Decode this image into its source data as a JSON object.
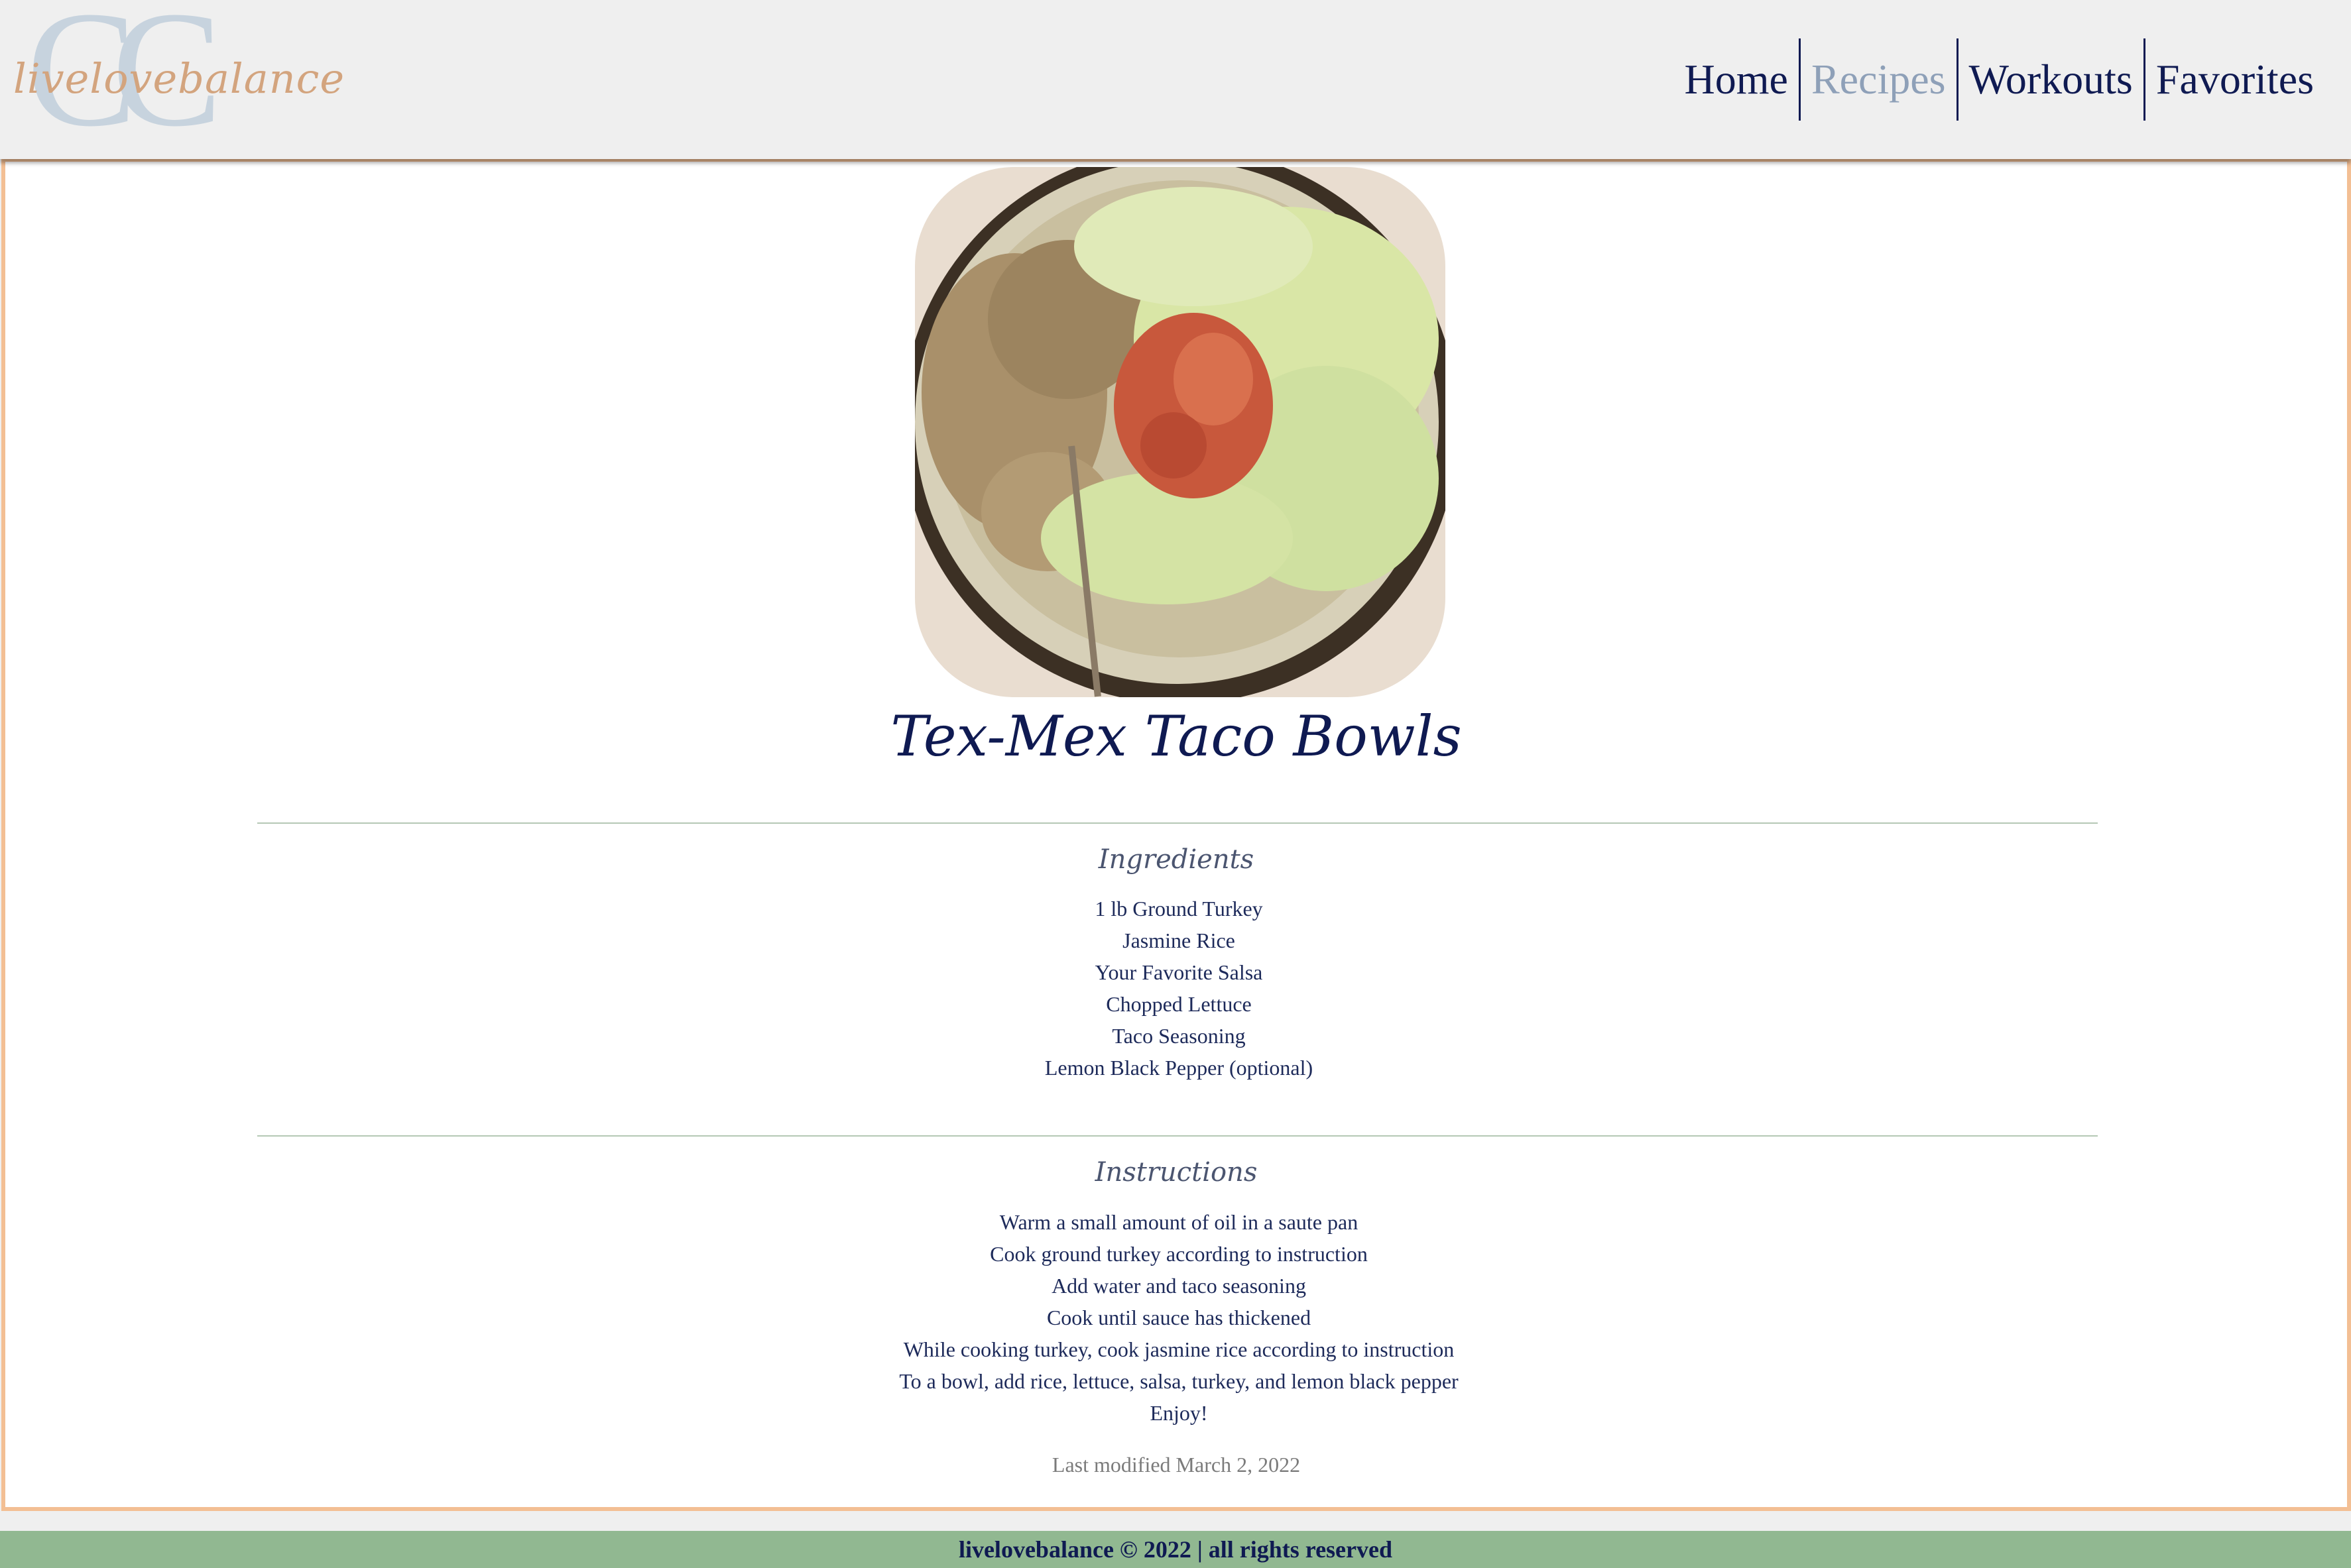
{
  "brand": {
    "monogram": "CC",
    "script": "livelovebalance"
  },
  "nav": {
    "items": [
      {
        "label": "Home",
        "active": false
      },
      {
        "label": "Recipes",
        "active": true
      },
      {
        "label": "Workouts",
        "active": false
      },
      {
        "label": "Favorites",
        "active": false
      }
    ]
  },
  "recipe": {
    "image_icon": "taco-bowl-photo",
    "title": "Tex-Mex Taco Bowls",
    "ingredients_heading": "Ingredients",
    "ingredients": [
      "1 lb Ground Turkey",
      "Jasmine Rice",
      "Your Favorite Salsa",
      "Chopped Lettuce",
      "Taco Seasoning",
      "Lemon Black Pepper (optional)"
    ],
    "instructions_heading": "Instructions",
    "instructions": [
      "Warm a small amount of oil in a saute pan",
      "Cook ground turkey according to instruction",
      "Add water and taco seasoning",
      "Cook until sauce has thickened",
      "While cooking turkey, cook jasmine rice according to instruction",
      "To a bowl, add rice, lettuce, salsa, turkey, and lemon black pepper",
      "Enjoy!"
    ],
    "last_modified": "Last modified March 2, 2022"
  },
  "footer": {
    "text": "livelovebalance © 2022 | all rights reserved"
  },
  "colors": {
    "navy": "#0f1a52",
    "active_nav": "#8ea0b8",
    "border": "#f3bf94",
    "footer_bg": "#91b891"
  }
}
